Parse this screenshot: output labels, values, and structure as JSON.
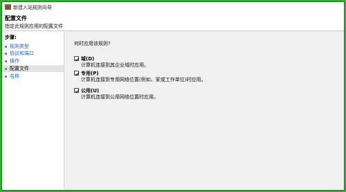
{
  "window": {
    "title": "新建入站规则向导"
  },
  "header": {
    "title": "配置文件",
    "subtitle": "指定此规则应用的配置文件"
  },
  "sidebar": {
    "heading": "步骤:",
    "items": [
      {
        "label": "规则类型",
        "active": false
      },
      {
        "label": "协议和端口",
        "active": false
      },
      {
        "label": "操作",
        "active": false
      },
      {
        "label": "配置文件",
        "active": true
      },
      {
        "label": "名称",
        "active": false
      }
    ]
  },
  "main": {
    "question": "何时应用该规则?",
    "options": [
      {
        "label": "域(D)",
        "description": "计算机连接到其企业域时应用。",
        "checked": true
      },
      {
        "label": "专用(P)",
        "description": "计算机连接到专用网络位置(例如，家或工作单位)时应用。",
        "checked": true
      },
      {
        "label": "公用(U)",
        "description": "计算机连接到公用网络位置时应用。",
        "checked": true
      }
    ]
  },
  "colors": {
    "frame": "#3aa83a",
    "step_dot": "#1a9a3a",
    "link": "#1f5fbf",
    "content_bg": "#f0f0f0"
  }
}
